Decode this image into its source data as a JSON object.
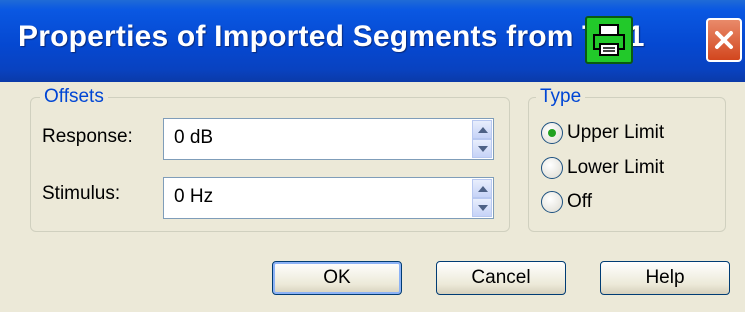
{
  "window": {
    "title": "Properties of Imported Segments from Trc1",
    "print_icon": "printer-icon",
    "close_icon": "close-icon",
    "accent_color": "#0548d1",
    "print_button_color": "#22c92a"
  },
  "offsets": {
    "legend": "Offsets",
    "response": {
      "label": "Response:",
      "value": "0 dB"
    },
    "stimulus": {
      "label": "Stimulus:",
      "value": "0 Hz"
    }
  },
  "type": {
    "legend": "Type",
    "selected": "Upper Limit",
    "options": [
      {
        "label": "Upper Limit",
        "selected": true
      },
      {
        "label": "Lower Limit",
        "selected": false
      },
      {
        "label": "Off",
        "selected": false
      }
    ]
  },
  "buttons": {
    "ok": "OK",
    "cancel": "Cancel",
    "help": "Help"
  }
}
